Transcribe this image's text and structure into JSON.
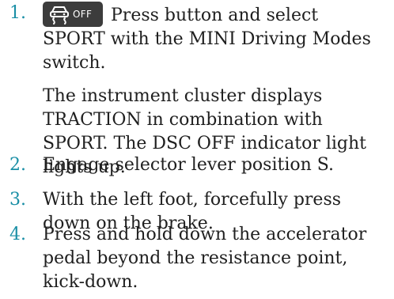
{
  "steps": [
    {
      "number": "1.",
      "icon": "dsc-off-icon",
      "icon_label": "OFF",
      "text": "Press button and select SPORT with the MINI Driving Modes switch.",
      "note": "The instrument cluster displays TRACTION in combination with SPORT. The DSC OFF indicator light lights up."
    },
    {
      "number": "2.",
      "text": "Engage selector lever position S."
    },
    {
      "number": "3.",
      "text": "With the left foot, forcefully press down on the brake."
    },
    {
      "number": "4.",
      "text": "Press and hold down the accelerator pedal beyond the resistance point, kick-down."
    }
  ],
  "colors": {
    "number": "#1a8fa6",
    "text": "#1f1f1f",
    "icon_bg": "#3c3c3c"
  }
}
